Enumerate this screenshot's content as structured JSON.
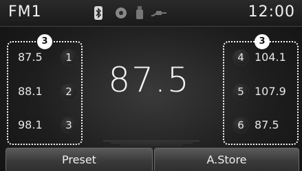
{
  "status_bar": {
    "band": "FM1",
    "time": "12:00",
    "icons": [
      "bluetooth-icon",
      "disc-icon",
      "usb-icon",
      "aux-cable-icon"
    ]
  },
  "current_frequency": "87.5",
  "callout_marker": "3",
  "presets_left": [
    {
      "number": "1",
      "frequency": "87.5"
    },
    {
      "number": "2",
      "frequency": "88.1"
    },
    {
      "number": "3",
      "frequency": "98.1"
    }
  ],
  "presets_right": [
    {
      "number": "4",
      "frequency": "104.1"
    },
    {
      "number": "5",
      "frequency": "107.9"
    },
    {
      "number": "6",
      "frequency": "87.5"
    }
  ],
  "softkeys": {
    "preset_label": "Preset",
    "astore_label": "A.Store"
  }
}
